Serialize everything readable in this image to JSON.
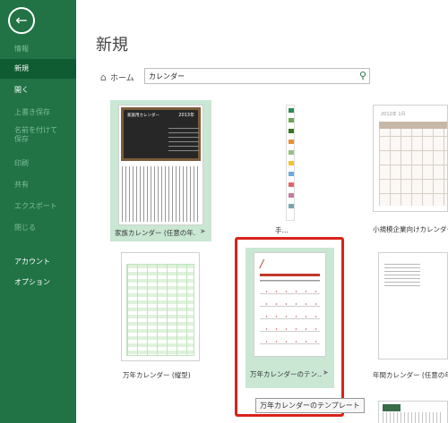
{
  "sidebar": {
    "items": [
      {
        "label": "情報"
      },
      {
        "label": "新規"
      },
      {
        "label": "開く"
      },
      {
        "label": "上書き保存"
      },
      {
        "label": "名前を付けて保存"
      },
      {
        "label": "印刷"
      },
      {
        "label": "共有"
      },
      {
        "label": "エクスポート"
      },
      {
        "label": "閉じる"
      },
      {
        "label": "アカウント"
      },
      {
        "label": "オプション"
      }
    ]
  },
  "main": {
    "title": "新規",
    "home_label": "ホーム",
    "search": {
      "value": "カレンダー"
    },
    "templates": [
      {
        "label": "家族カレンダー (任意の年…",
        "thumb_title": "家族用カレンダー",
        "thumb_year": "2013年"
      },
      {
        "label": "手…"
      },
      {
        "label": "小規模企業向けカレンダー…",
        "thumb_title": "2012年 1月"
      },
      {
        "label": "万年カレンダー (縦型)"
      },
      {
        "label": "万年カレンダーのテン…",
        "thumb_mark": "/",
        "selected": true
      },
      {
        "label": "年間カレンダー (任意の年…"
      }
    ],
    "tooltip": "万年カレンダーのテンプレート"
  },
  "colors": {
    "sidebar_bg": "#217346",
    "sidebar_active": "#0f5c32",
    "selection_frame": "#d9231a",
    "tile_highlight": "#c9e7d3"
  },
  "icons": {
    "back": "back-arrow-icon",
    "home": "home-icon",
    "search": "search-icon",
    "pin": "pin-icon"
  }
}
